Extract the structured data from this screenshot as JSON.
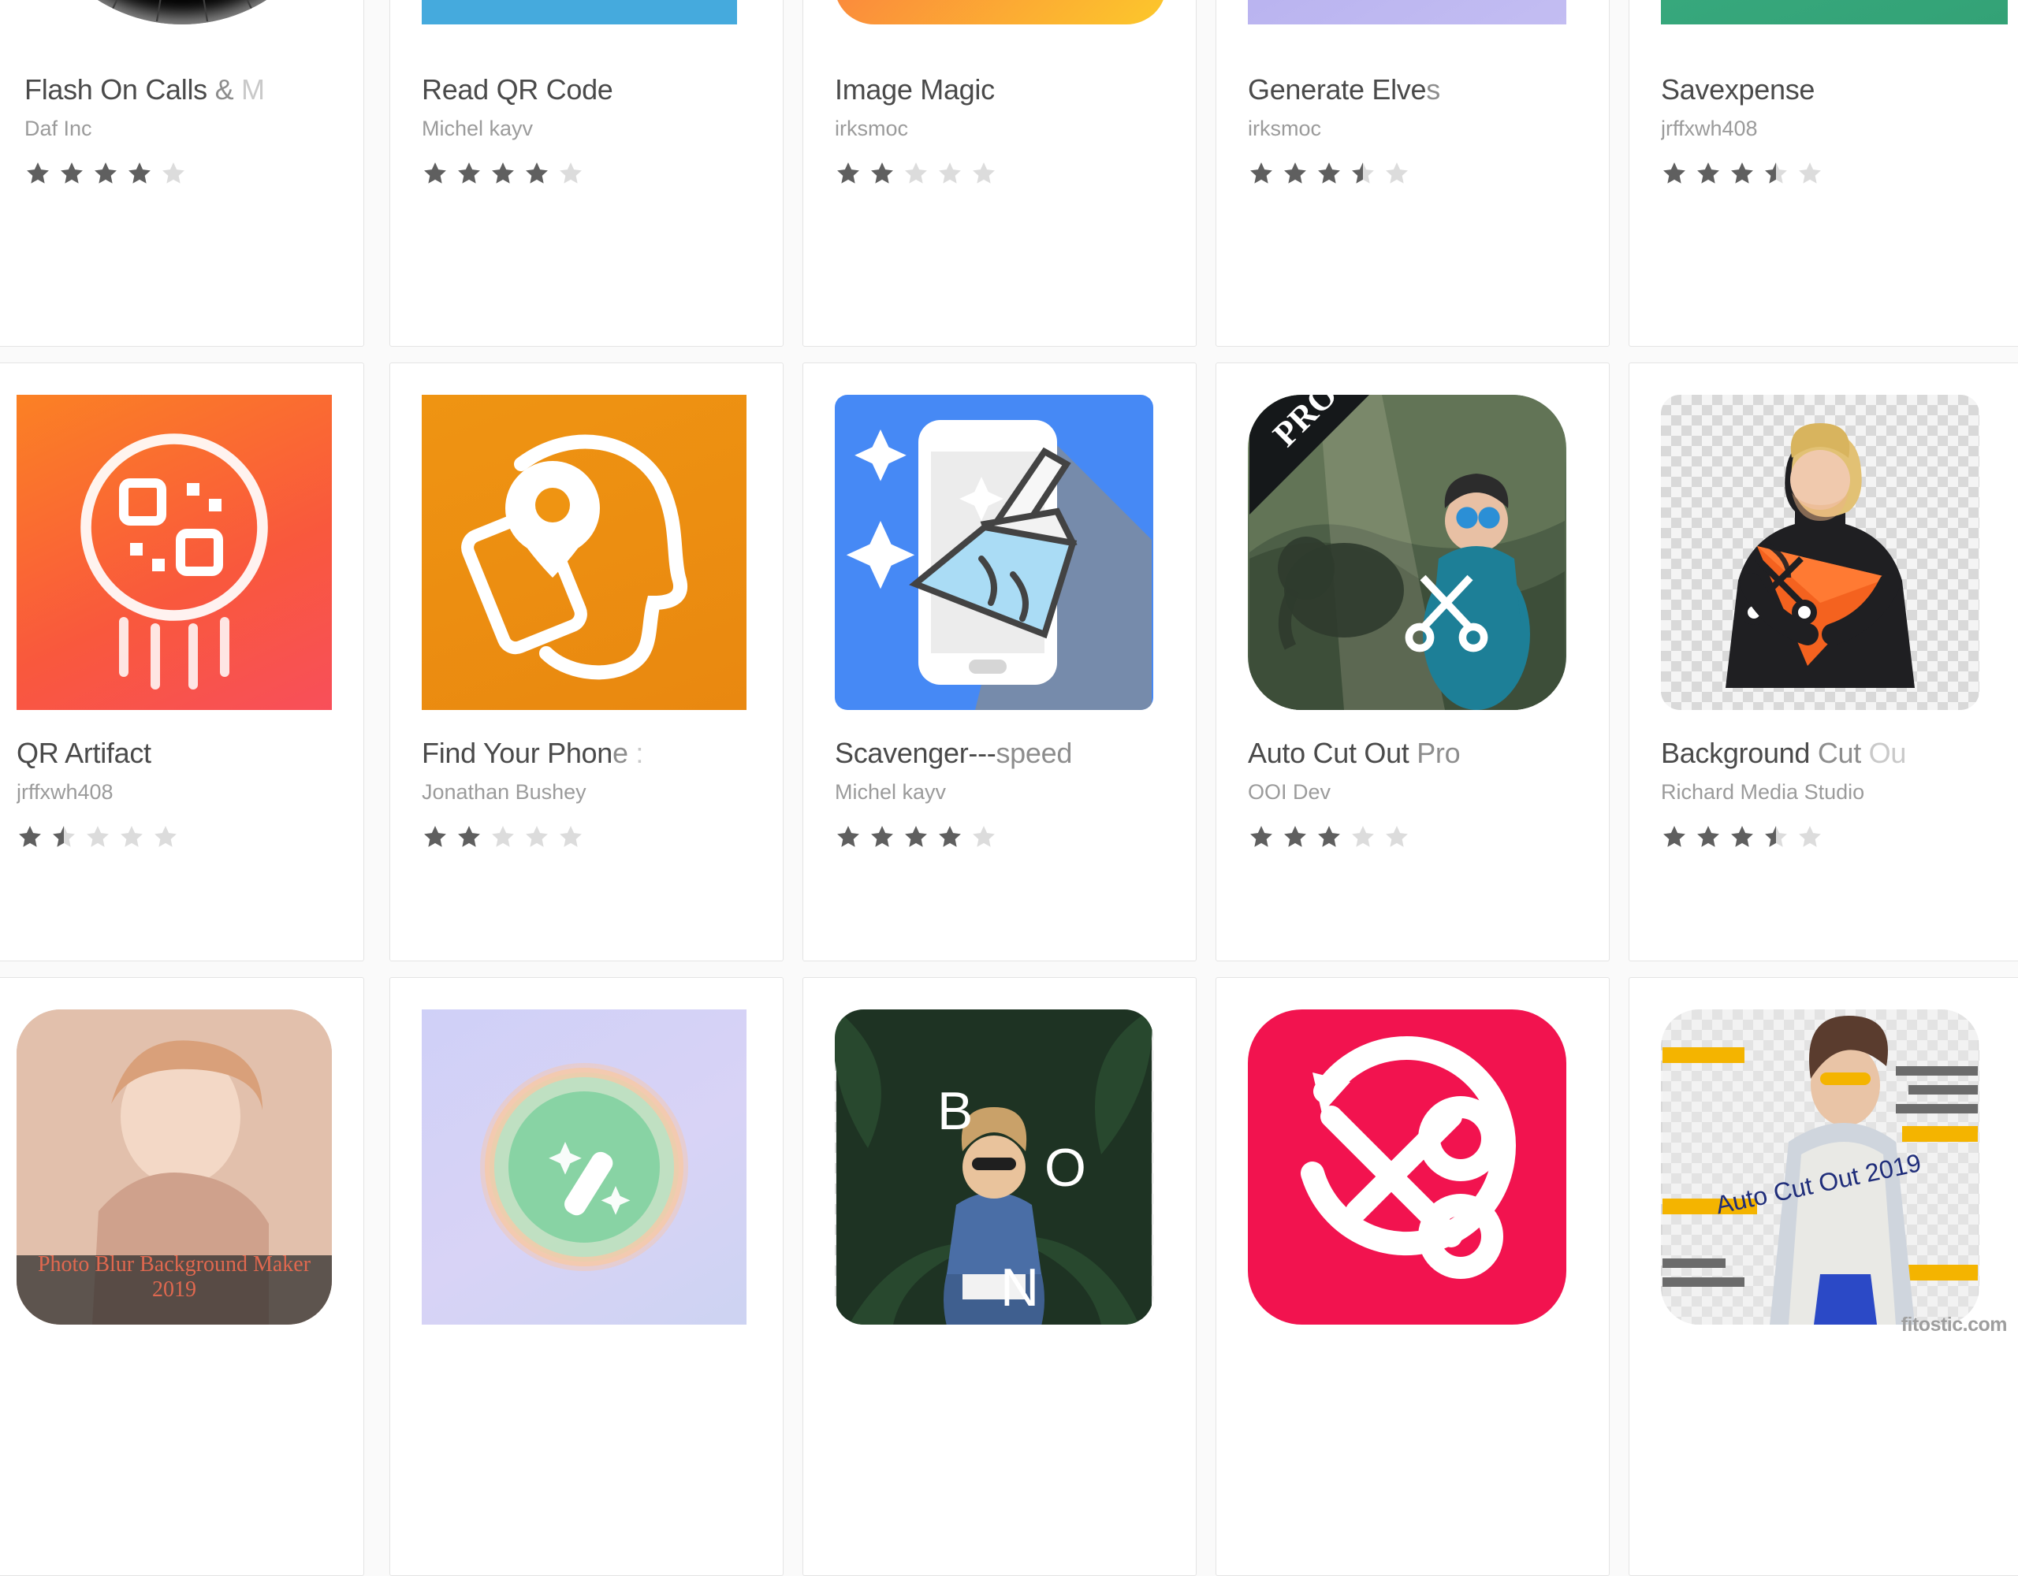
{
  "page": {
    "context": "google-play-app-grid",
    "watermark": "fitostic.com"
  },
  "grid": {
    "columns": 5,
    "rows": [
      {
        "row_index": 1,
        "apps": [
          {
            "title": "Flash On Calls & M",
            "title_plain": "Flash On Calls & M",
            "title_head": "Flash On Calls",
            "title_fade1": " &",
            "title_fade2": " M",
            "developer": "Daf Inc",
            "rating": 4,
            "icon_name": "flash-on-calls-icon"
          },
          {
            "title": "Read QR Code",
            "title_head": "Read QR Code",
            "title_fade1": "",
            "title_fade2": "",
            "developer": "Michel kayv",
            "rating": 4,
            "icon_name": "read-qr-code-icon"
          },
          {
            "title": "Image Magic",
            "title_head": "Image Magic",
            "title_fade1": "",
            "title_fade2": "",
            "developer": "irksmoc",
            "rating": 2,
            "icon_name": "image-magic-icon"
          },
          {
            "title": "Generate Elves",
            "title_head": "Generate Elve",
            "title_fade1": "s",
            "title_fade2": "",
            "developer": "irksmoc",
            "rating": 3.5,
            "icon_name": "generate-elves-icon"
          },
          {
            "title": "Savexpense",
            "title_head": "Savexpense",
            "title_fade1": "",
            "title_fade2": "",
            "developer": "jrffxwh408",
            "rating": 3.5,
            "icon_name": "savexpense-icon"
          }
        ]
      },
      {
        "row_index": 2,
        "apps": [
          {
            "title": "QR Artifact",
            "title_head": "QR Artifact",
            "title_fade1": "",
            "title_fade2": "",
            "developer": "jrffxwh408",
            "rating": 1.5,
            "icon_name": "qr-artifact-icon"
          },
          {
            "title": "Find Your Phone :",
            "title_head": "Find Your Phon",
            "title_fade1": "e",
            "title_fade2": " :",
            "developer": "Jonathan Bushey",
            "rating": 2,
            "icon_name": "find-your-phone-icon"
          },
          {
            "title": "Scavenger---speed",
            "title_head": "Scavenger---",
            "title_fade1": "speed",
            "title_fade2": "",
            "developer": "Michel kayv",
            "rating": 4,
            "icon_name": "scavenger-speed-icon"
          },
          {
            "title": "Auto Cut Out Pro",
            "title_head": "Auto Cut Out",
            "title_fade1": " Pro",
            "title_fade2": "",
            "developer": "OOI Dev",
            "rating": 3,
            "icon_name": "auto-cut-out-pro-icon"
          },
          {
            "title": "Background Cut Ou",
            "title_head": "Background",
            "title_fade1": " Cut",
            "title_fade2": " Ou",
            "developer": "Richard Media Studio",
            "rating": 3.5,
            "icon_name": "background-cut-out-icon"
          }
        ]
      },
      {
        "row_index": 3,
        "apps": [
          {
            "title": "",
            "title_head": "",
            "title_fade1": "",
            "title_fade2": "",
            "developer": "",
            "rating": 0,
            "icon_name": "photo-blur-background-maker-icon",
            "icon_caption": "Photo Blur Background Maker 2019"
          },
          {
            "title": "",
            "title_head": "",
            "title_fade1": "",
            "title_fade2": "",
            "developer": "",
            "rating": 0,
            "icon_name": "pastel-orb-icon"
          },
          {
            "title": "",
            "title_head": "",
            "title_fade1": "",
            "title_fade2": "",
            "developer": "",
            "rating": 0,
            "icon_name": "boon-photo-icon",
            "icon_caption": "B O N"
          },
          {
            "title": "",
            "title_head": "",
            "title_fade1": "",
            "title_fade2": "",
            "developer": "",
            "rating": 0,
            "icon_name": "scissors-rotate-icon"
          },
          {
            "title": "",
            "title_head": "",
            "title_fade1": "",
            "title_fade2": "",
            "developer": "",
            "rating": 0,
            "icon_name": "auto-cut-out-2019-icon",
            "icon_caption": "Auto Cut Out 2019"
          }
        ]
      }
    ]
  },
  "colors": {
    "card_bg": "#ffffff",
    "page_bg": "#fafafa",
    "card_border": "#e4e4e4",
    "title_text": "#4a4a4a",
    "dev_text": "#9b9b9b",
    "star_on": "#5f5f5f",
    "star_off": "#dcdcdc",
    "qr_blue": "#45aadd",
    "image_magic_orange": "#f97a3d",
    "generate_elves_violet": "#8e8ef0",
    "savexpense_green": "#3aab7c",
    "qr_artifact_red": "#f8533f",
    "find_phone_orange": "#ef8f18",
    "scavenger_blue": "#4689f5",
    "scissors_pink": "#f2134f"
  }
}
